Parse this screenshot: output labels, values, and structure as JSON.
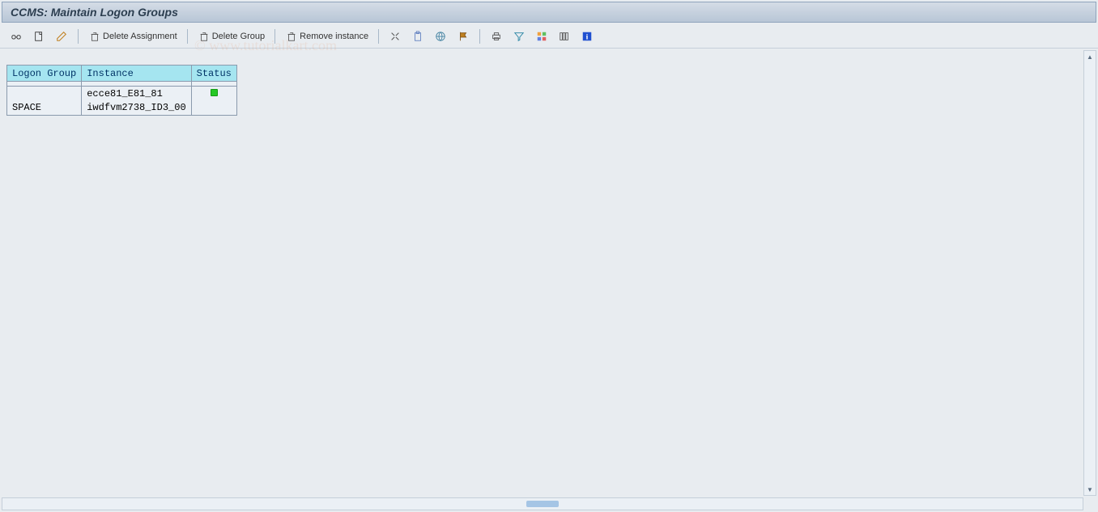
{
  "title": "CCMS: Maintain Logon Groups",
  "toolbar": {
    "delete_assignment": "Delete Assignment",
    "delete_group": "Delete Group",
    "remove_instance": "Remove instance"
  },
  "table": {
    "headers": {
      "logon_group": "Logon Group",
      "instance": "Instance",
      "status": "Status"
    },
    "rows": [
      {
        "logon_group": "",
        "instance": "ecce81_E81_81",
        "status": "green"
      },
      {
        "logon_group": "SPACE",
        "instance": "iwdfvm2738_ID3_00",
        "status": ""
      }
    ]
  },
  "watermark": "© www.tutorialkart.com"
}
